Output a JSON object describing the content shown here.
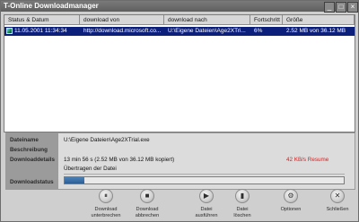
{
  "window": {
    "title": "T-Online Downloadmanager"
  },
  "window_buttons": {
    "minimize": "_",
    "maximize": "□",
    "close": "×"
  },
  "list": {
    "columns": [
      "Status & Datum",
      "download von",
      "download nach",
      "Fortschritt",
      "Größe"
    ],
    "rows": [
      {
        "status_date": "11.05.2001 11:34:34",
        "from": "http://download.microsoft.co...",
        "to": "U:\\Eigene Dateien\\Age2XTri...",
        "progress": "6%",
        "size": "2.52 MB von 36.12 MB",
        "selected": true
      }
    ]
  },
  "details": {
    "labels": {
      "filename": "Dateiname",
      "description": "Beschreibung",
      "download_details": "Downloaddetails",
      "download_status": "Downloadstatus"
    },
    "filename": "U:\\Eigene Dateien\\Age2XTrial.exe",
    "description": "",
    "download_details": "13 min 56 s (2.52 MB von 36.12 MB kopiert)",
    "speed": "42 KB/s Resume",
    "status_text": "Übertragen der Datei",
    "progress_fraction": 0.07
  },
  "buttons": [
    {
      "label": "Download\nunterbrechen",
      "icon": "pause-icon",
      "glyph": "⏸"
    },
    {
      "label": "Download\nabbrechen",
      "icon": "stop-icon",
      "glyph": "■"
    },
    {
      "label": "Datei\nausführen",
      "icon": "play-icon",
      "glyph": "▶"
    },
    {
      "label": "Datei\nlöschen",
      "icon": "delete-icon",
      "glyph": "▮"
    },
    {
      "label": "Optionen",
      "icon": "options-icon",
      "glyph": "⚙"
    },
    {
      "label": "Schließen",
      "icon": "close-icon",
      "glyph": "✕"
    }
  ],
  "colors": {
    "selection": "#0c1f7a",
    "resume_text": "#d42020",
    "progress_fill": "#3a6fa6"
  }
}
